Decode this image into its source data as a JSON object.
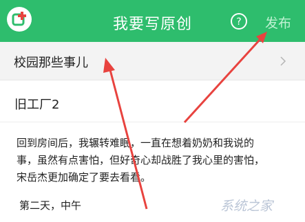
{
  "header": {
    "title": "我要写原创",
    "publish_label": "发布",
    "app_icon": "edit-plus-icon",
    "help_icon": "question-circle-icon",
    "background": "#2ebd6d"
  },
  "category": {
    "label": "校园那些事儿",
    "chevron": "chevron-right-icon"
  },
  "article": {
    "title": "旧工厂2",
    "body_lines": [
      "回到房间后，我辗转难眠，一直在想着奶奶和我说的",
      "事，虽然有点害怕，但好奇心却战胜了我心里的害怕，",
      "宋岳杰更加确定了要去看看。"
    ],
    "next_paragraph": "第二天，中午"
  },
  "watermark": {
    "text": "系统之家"
  },
  "annotation_color": "#e8433f"
}
